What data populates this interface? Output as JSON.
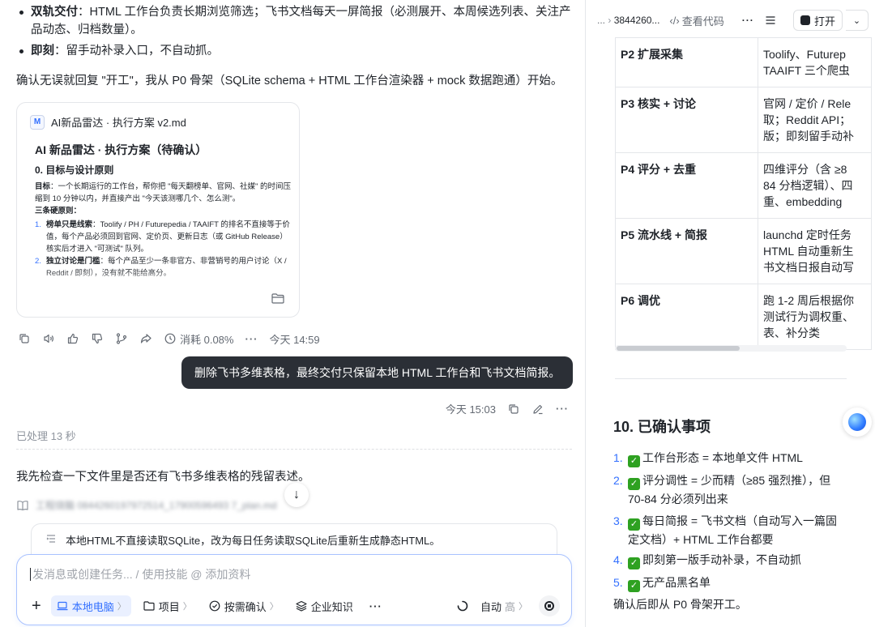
{
  "chat": {
    "bullet1_title": "双轨交付",
    "bullet1_text": "：HTML 工作台负责长期浏览筛选；飞书文档每天一屏简报（必测展开、本周候选列表、关注产品动态、归档数量）。",
    "bullet2_title": "即刻",
    "bullet2_text": "：留手动补录入口，不自动抓。",
    "confirm_text": "确认无误就回复 \"开工\"，我从 P0 骨架（SQLite schema + HTML 工作台渲染器 + mock 数据跑通）开始。",
    "doc_card": {
      "file_name": "AI新品雷达 · 执行方案 v2.md",
      "title": "AI 新品雷达 · 执行方案（待确认）",
      "section": "0. 目标与设计原则",
      "goal_label": "目标",
      "goal_text": "：一个长期运行的工作台，帮你把 \"每天翻榜单、官网、社媒\" 的时间压缩到 10 分钟以内，并直接产出 \"今天该测哪几个、怎么测\"。",
      "rules_label": "三条硬原则：",
      "rule1_num": "1.",
      "rule1_title": "榜单只是线索",
      "rule1_text": "：Toolify / PH / Futurepedia / TAAIFT 的排名不直接等于价值，每个产品必须回到官网、定价页、更新日志（或 GitHub Release）核实后才进入 \"可测试\" 队列。",
      "rule2_num": "2.",
      "rule2_title": "独立讨论是门槛",
      "rule2_text": "：每个产品至少一条非官方、非营销号的用户讨论（X / Reddit / 即刻），没有就不能给高分。"
    },
    "actions": {
      "usage": "消耗 0.08%",
      "time": "今天 14:59"
    },
    "user_message": "删除飞书多维表格，最终交付只保留本地 HTML 工作台和飞书文档简报。",
    "user_time": "今天 15:03",
    "processed": "已处理 13 秒",
    "check_text": "我先检查一下文件里是否还有飞书多维表格的残留表述。",
    "file_ref": "工程烧脑 0844260197972514_17900596493 7_plan.md",
    "suggestion": "本地HTML不直接读取SQLite，改为每日任务读取SQLite后重新生成静态HTML。",
    "input": {
      "placeholder": "发消息或创建任务... / 使用技能 @ 添加资料",
      "local": "本地电脑",
      "project": "项目",
      "confirm": "按需确认",
      "knowledge": "企业知识",
      "mode": "自动",
      "mode_level": "高"
    }
  },
  "right": {
    "breadcrumb_prefix": "...",
    "breadcrumb_id": "3844260...",
    "view_code": "查看代码",
    "open": "打开",
    "phases": [
      {
        "phase": "P2 扩展采集",
        "desc1": "Toolify、Futurep",
        "desc2": "TAAIFT 三个爬虫",
        "desc3": ""
      },
      {
        "phase": "P3 核实 + 讨论",
        "desc1": "官网 / 定价 / Rele",
        "desc2": "取；Reddit API；",
        "desc3": "版；即刻留手动补"
      },
      {
        "phase": "P4 评分 + 去重",
        "desc1": "四维评分（含 ≥8",
        "desc2": "84 分档逻辑）、四",
        "desc3": "重、embedding"
      },
      {
        "phase": "P5 流水线 + 简报",
        "desc1": "launchd 定时任务",
        "desc2": "HTML 自动重新生",
        "desc3": "书文档日报自动写"
      },
      {
        "phase": "P6 调优",
        "desc1": "跑 1-2 周后根据你",
        "desc2": "测试行为调权重、",
        "desc3": "表、补分类"
      }
    ],
    "section_title": "10. 已确认事项",
    "confirmed": [
      {
        "n": "1.",
        "text": "工作台形态 = 本地单文件 HTML"
      },
      {
        "n": "2.",
        "text": "评分调性 = 少而精（≥85 强烈推），但 70-84 分必须列出来"
      },
      {
        "n": "3.",
        "text": "每日简报 = 飞书文档（自动写入一篇固定文档）+ HTML 工作台都要"
      },
      {
        "n": "4.",
        "text": "即刻第一版手动补录，不自动抓"
      },
      {
        "n": "5.",
        "text": "无产品黑名单"
      }
    ],
    "final_line": "确认后即从 P0 骨架开工。"
  },
  "colors": {
    "accent": "#3370ff",
    "bubble": "#2b2f36",
    "check_green": "#2ea121"
  }
}
